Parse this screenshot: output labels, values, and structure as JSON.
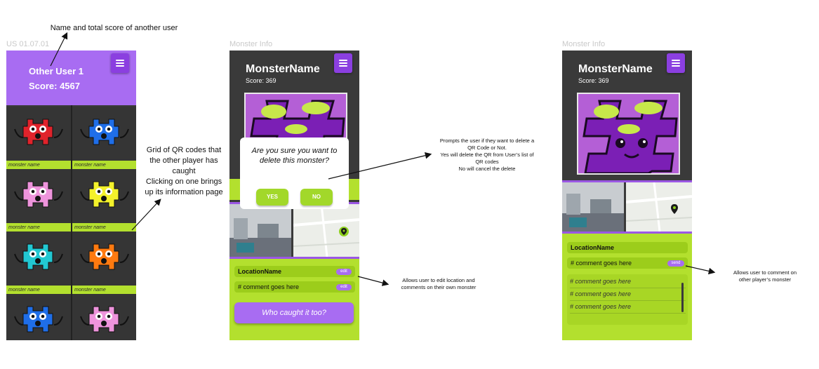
{
  "frames": {
    "screen1_label": "US 01.07.01",
    "screen2_label": "Monster Info",
    "screen3_label": "Monster Info"
  },
  "annotations": {
    "top_note": "Name and total score of another user",
    "grid_note": [
      "Grid of  QR codes that",
      "the other player has",
      "caught",
      "Clicking on one brings",
      "up its information page"
    ],
    "delete_note": [
      "Prompts the user if they want to delete a",
      "QR Code or Not.",
      "Yes will delete the QR from User’s list of",
      "QR codes",
      "No will cancel the delete"
    ],
    "edit_note": [
      "Allows user to edit location and",
      "comments on their own monster"
    ],
    "comment_note": [
      "Allows user to comment on",
      "other player’s monster"
    ]
  },
  "other_user": {
    "name": "Other User 1",
    "score": "Score: 4567",
    "grid": [
      {
        "label": "monster name",
        "color": "#e0232b"
      },
      {
        "label": "monster name",
        "color": "#1f6ee8"
      },
      {
        "label": "monster name",
        "color": "#ee94dc"
      },
      {
        "label": "monster name",
        "color": "#f4f22b"
      },
      {
        "label": "monster name",
        "color": "#22c8d2"
      },
      {
        "label": "monster name",
        "color": "#ff7a10"
      },
      {
        "label": "",
        "color": "#1f6ee8"
      },
      {
        "label": "",
        "color": "#ee94dc"
      }
    ]
  },
  "own_monster": {
    "title": "MonsterName",
    "score": "Score: 369",
    "dialog_question": "Are you sure you want to delete this monster?",
    "yes": "YES",
    "no": "NO",
    "location": "LocationName",
    "comment": "# comment goes here",
    "edit1": "edit",
    "edit2": "edit",
    "who_button": "Who caught it too?"
  },
  "other_monster": {
    "title": "MonsterName",
    "score": "Score: 369",
    "location": "LocationName",
    "comment_input": "# comment goes here",
    "send": "send",
    "comments": [
      "# comment goes here",
      "# comment goes here",
      "# comment goes here"
    ]
  },
  "colors": {
    "purple": "#a86cf2",
    "dark_purple": "#8b3fe0",
    "lime": "#b3e02e",
    "dark_bg": "#3a3a3a"
  },
  "icons": [
    "menu-icon",
    "map-pin-icon",
    "arrow-icon"
  ]
}
